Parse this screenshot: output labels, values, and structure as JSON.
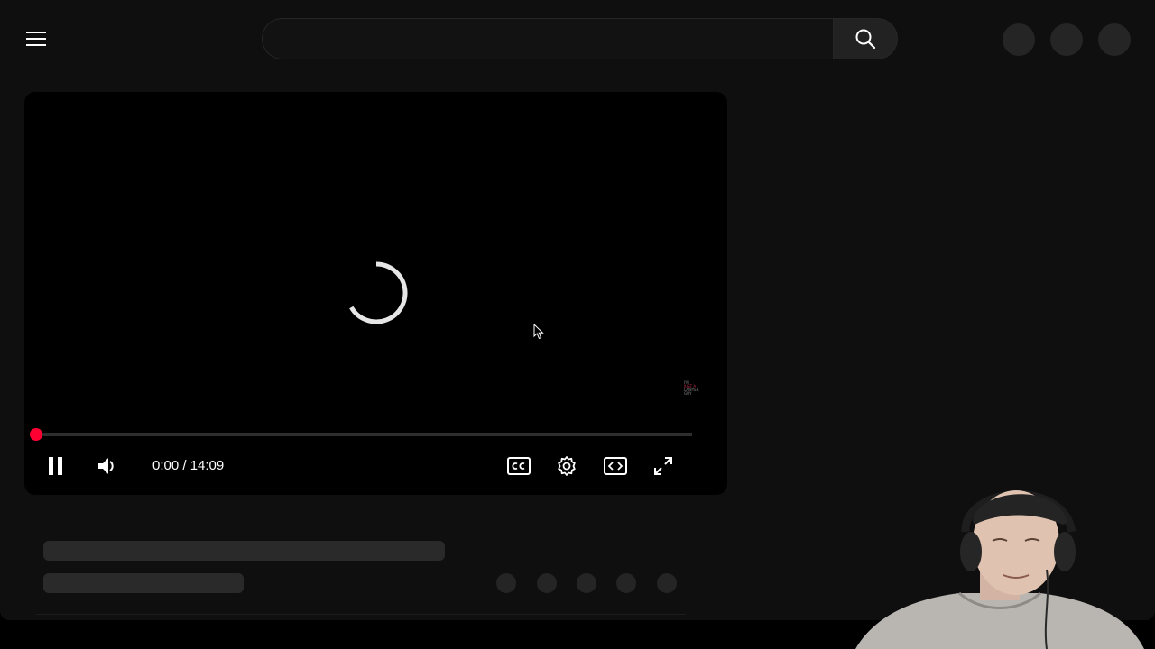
{
  "header": {
    "menu_icon": "hamburger-menu-icon",
    "search_placeholder": "",
    "search_icon": "search-icon",
    "action_buttons": [
      "action-placeholder-1",
      "action-placeholder-2",
      "action-placeholder-3"
    ]
  },
  "player": {
    "state": "loading",
    "spinner_icon": "loading-spinner-icon",
    "current_time": "0:00",
    "duration": "14:09",
    "time_text": "0:00 / 14:09",
    "progress": 0,
    "accent_color": "#ff0033",
    "controls": {
      "play_pause_icon": "pause-icon",
      "volume_icon": "volume-icon",
      "captions_icon": "closed-captions-icon",
      "settings_icon": "gear-icon",
      "theater_icon": "theater-mode-icon",
      "fullscreen_icon": "fullscreen-icon"
    },
    "watermark": {
      "line1": "I'M",
      "line2": "JUST A",
      "line3": "LAWYER",
      "line4": "GUY"
    }
  },
  "below_video": {
    "title_placeholder": "",
    "meta_placeholder": "",
    "action_dots": 5
  },
  "overlay": {
    "webcam": "streamer-webcam"
  }
}
